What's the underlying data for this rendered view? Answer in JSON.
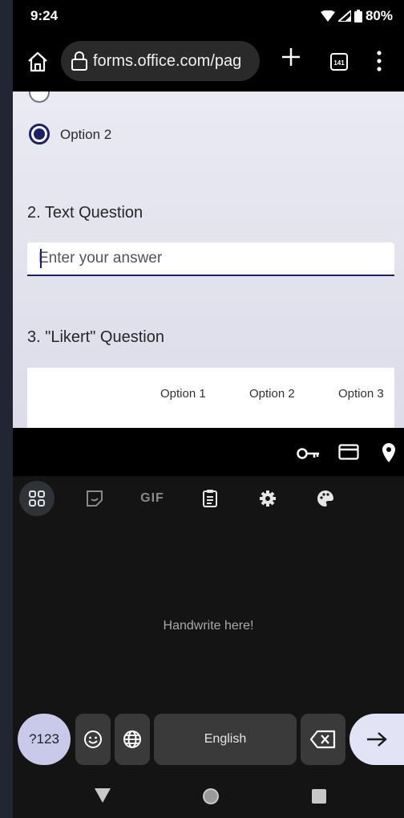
{
  "status": {
    "time": "9:24",
    "battery": "80%"
  },
  "browser": {
    "url": "forms.office.com/pag",
    "tab_count": "141"
  },
  "form": {
    "q1_selected_option": "Option 2",
    "q2_title": "2. Text Question",
    "q2_placeholder": "Enter your answer",
    "q3_title": "3. \"Likert\" Question",
    "likert_columns": [
      "Option 1",
      "Option 2",
      "Option 3"
    ]
  },
  "keyboard": {
    "handwrite_hint": "Handwrite here!",
    "symbols_key": "?123",
    "space_label": "English",
    "gif_label": "GIF",
    "accent": "#c9c9e9"
  },
  "icons": [
    "home-icon",
    "lock-icon",
    "plus-icon",
    "tabs-icon",
    "more-vert-icon",
    "key-icon",
    "card-icon",
    "location-pin-icon",
    "apps-grid-icon",
    "sticker-icon",
    "clipboard-icon",
    "settings-icon",
    "palette-icon",
    "emoji-icon",
    "globe-icon",
    "backspace-icon",
    "enter-arrow-icon",
    "back-icon",
    "home-nav-icon",
    "recents-icon"
  ]
}
